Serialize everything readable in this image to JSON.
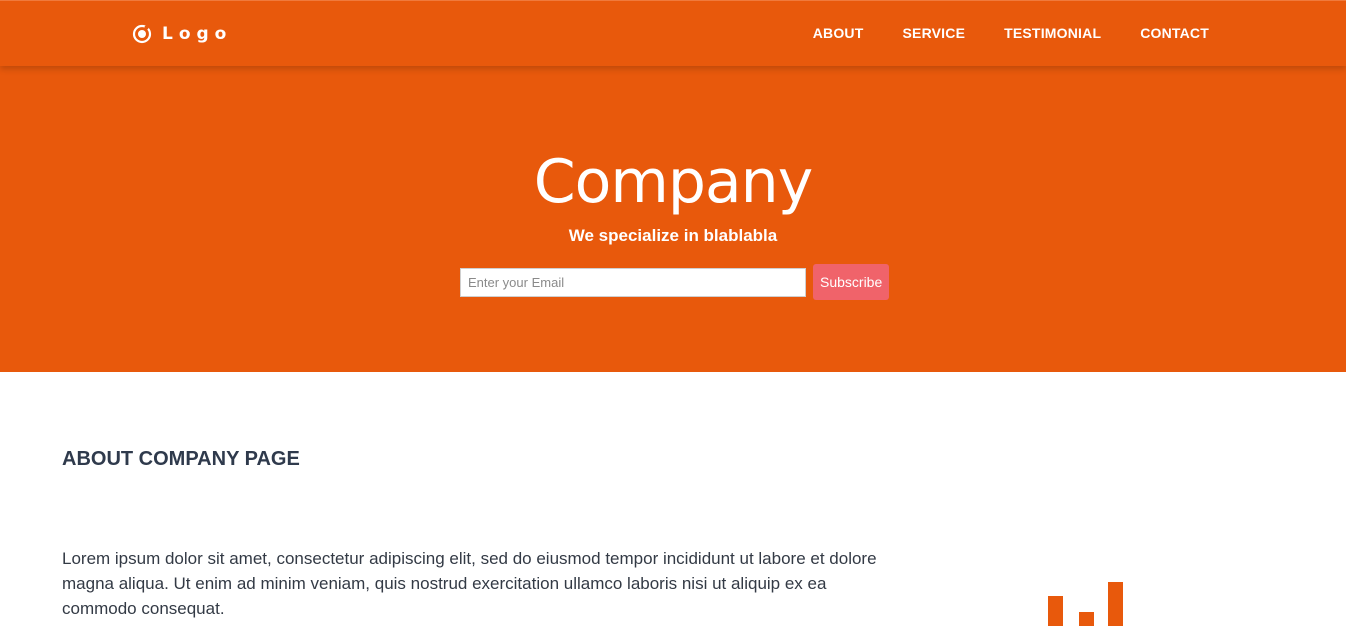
{
  "header": {
    "logo_text": "Logo",
    "logo_icon": "target-circle-icon",
    "nav": [
      {
        "label": "ABOUT"
      },
      {
        "label": "SERVICE"
      },
      {
        "label": "TESTIMONIAL"
      },
      {
        "label": "CONTACT"
      }
    ]
  },
  "hero": {
    "title": "Company",
    "subtitle": "We specialize in blablabla",
    "email_placeholder": "Enter your Email",
    "subscribe_label": "Subscribe"
  },
  "about": {
    "title": "ABOUT COMPANY PAGE",
    "text": "Lorem ipsum dolor sit amet, consectetur adipiscing elit, sed do eiusmod tempor incididunt ut labore et dolore magna aliqua. Ut enim ad minim veniam, quis nostrud exercitation ullamco laboris nisi ut aliquip ex ea commodo consequat.",
    "illustration_icon": "bar-chart-icon"
  },
  "colors": {
    "brand": "#e8590c",
    "accent": "#f0636a",
    "heading": "#2f3a4c"
  }
}
